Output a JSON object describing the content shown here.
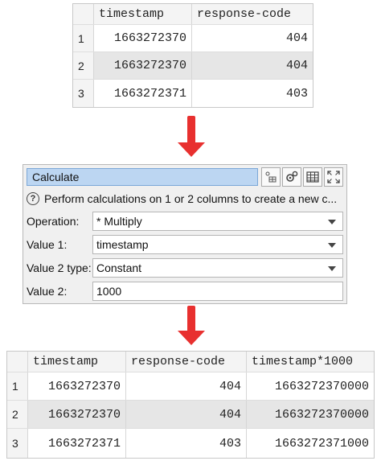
{
  "top_table": {
    "columns": [
      "timestamp",
      "response-code"
    ],
    "rows": [
      {
        "num": "1",
        "cells": [
          "1663272370",
          "404"
        ]
      },
      {
        "num": "2",
        "cells": [
          "1663272370",
          "404"
        ]
      },
      {
        "num": "3",
        "cells": [
          "1663272371",
          "403"
        ]
      }
    ]
  },
  "calculate_panel": {
    "title": "Calculate",
    "help_icon": "question-icon",
    "description": "Perform calculations on 1 or 2 columns to create a new c...",
    "fields": [
      {
        "label": "Operation:",
        "value": "* Multiply",
        "dropdown": true
      },
      {
        "label": "Value 1:",
        "value": "timestamp",
        "dropdown": true
      },
      {
        "label": "Value 2 type:",
        "value": "Constant",
        "dropdown": true
      },
      {
        "label": "Value 2:",
        "value": "1000",
        "dropdown": false
      }
    ],
    "toolbar_icons": [
      "column-pick-icon",
      "settings-icon",
      "table-icon",
      "maximize-icon"
    ]
  },
  "bottom_table": {
    "columns": [
      "timestamp",
      "response-code",
      "timestamp*1000"
    ],
    "rows": [
      {
        "num": "1",
        "cells": [
          "1663272370",
          "404",
          "1663272370000"
        ]
      },
      {
        "num": "2",
        "cells": [
          "1663272370",
          "404",
          "1663272370000"
        ]
      },
      {
        "num": "3",
        "cells": [
          "1663272371",
          "403",
          "1663272371000"
        ]
      }
    ]
  },
  "colors": {
    "arrow": "#e8302f",
    "title_bar": "#bcd6f2",
    "shaded_row": "#e6e6e6"
  }
}
